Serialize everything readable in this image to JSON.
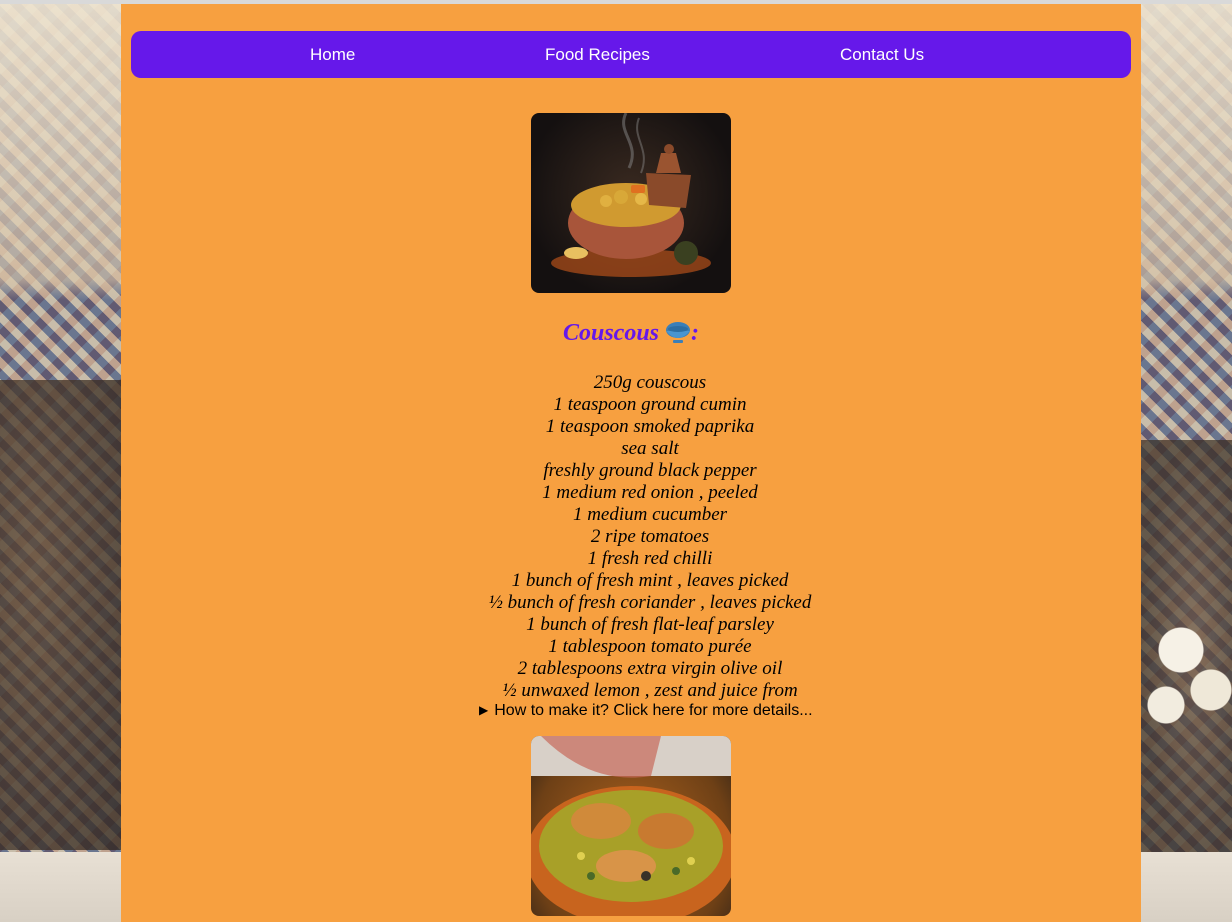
{
  "nav": {
    "items": [
      {
        "label": "Home"
      },
      {
        "label": "Food Recipes"
      },
      {
        "label": "Contact Us"
      }
    ]
  },
  "recipe": {
    "title": "Couscous",
    "title_suffix": ":",
    "title_icon": "bowl-icon",
    "ingredients": [
      "250g couscous",
      "1 teaspoon ground cumin",
      "1 teaspoon smoked paprika",
      "sea salt",
      "freshly ground black pepper",
      "1 medium red onion , peeled",
      "1 medium cucumber",
      "2 ripe tomatoes",
      "1 fresh red chilli",
      "1 bunch of fresh mint , leaves picked",
      "½ bunch of fresh coriander , leaves picked",
      "1 bunch of fresh flat-leaf parsley",
      "1 tablespoon tomato purée",
      "2 tablespoons extra virgin olive oil",
      "½ unwaxed lemon , zest and juice from"
    ],
    "details_summary": "How to make it? Click here for more details..."
  },
  "colors": {
    "panel": "#f7a040",
    "navbar": "#6618ea",
    "title": "#6618ea"
  }
}
